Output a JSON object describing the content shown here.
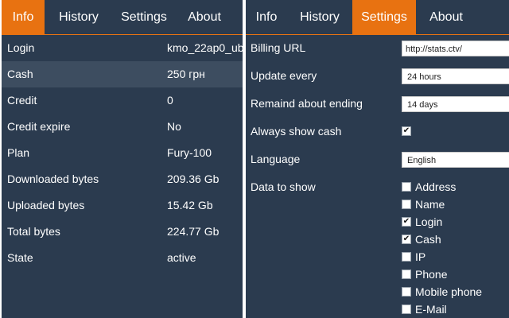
{
  "left": {
    "tabs": [
      {
        "label": "Info",
        "active": true
      },
      {
        "label": "History",
        "active": false
      },
      {
        "label": "Settings",
        "active": false
      },
      {
        "label": "About",
        "active": false
      }
    ],
    "rows": [
      {
        "label": "Login",
        "value": "kmo_22ap0_ub"
      },
      {
        "label": "Cash",
        "value": "250 грн"
      },
      {
        "label": "Credit",
        "value": "0"
      },
      {
        "label": "Credit expire",
        "value": "No"
      },
      {
        "label": "Plan",
        "value": "Fury-100"
      },
      {
        "label": "Downloaded bytes",
        "value": "209.36 Gb"
      },
      {
        "label": "Uploaded bytes",
        "value": "15.42 Gb"
      },
      {
        "label": "Total bytes",
        "value": "224.77 Gb"
      },
      {
        "label": "State",
        "value": "active"
      }
    ]
  },
  "right": {
    "tabs": [
      {
        "label": "Info",
        "active": false
      },
      {
        "label": "History",
        "active": false
      },
      {
        "label": "Settings",
        "active": true
      },
      {
        "label": "About",
        "active": false
      }
    ],
    "settings": {
      "billing_url": {
        "label": "Billing URL",
        "value": "http://stats.ctv/"
      },
      "update_every": {
        "label": "Update every",
        "value": "24 hours"
      },
      "remind": {
        "label": "Remaind about ending",
        "value": "14 days"
      },
      "always_show_cash": {
        "label": "Always show cash",
        "checked": true,
        "mark": "✔"
      },
      "language": {
        "label": "Language",
        "value": "English"
      },
      "data_to_show": {
        "label": "Data to show",
        "options": [
          {
            "label": "Address",
            "checked": false,
            "mark": ""
          },
          {
            "label": "Name",
            "checked": false,
            "mark": ""
          },
          {
            "label": "Login",
            "checked": true,
            "mark": "✔"
          },
          {
            "label": "Cash",
            "checked": true,
            "mark": "✔"
          },
          {
            "label": "IP",
            "checked": false,
            "mark": ""
          },
          {
            "label": "Phone",
            "checked": false,
            "mark": ""
          },
          {
            "label": "Mobile phone",
            "checked": false,
            "mark": ""
          },
          {
            "label": "E-Mail",
            "checked": false,
            "mark": ""
          }
        ]
      }
    }
  },
  "colors": {
    "panel_bg": "#2b3b4f",
    "accent": "#e87211",
    "row_highlight": "#3d4d60"
  }
}
